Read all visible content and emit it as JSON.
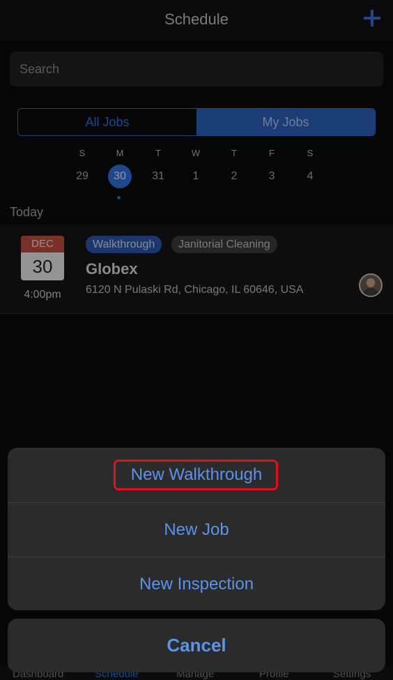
{
  "header": {
    "title": "Schedule",
    "add_icon": "plus-icon",
    "accent_color": "#2f6fd6"
  },
  "search": {
    "placeholder": "Search",
    "value": ""
  },
  "segments": {
    "all": "All Jobs",
    "mine": "My Jobs",
    "selected": "My Jobs"
  },
  "week": [
    {
      "label": "S",
      "date": "29",
      "selected": false
    },
    {
      "label": "M",
      "date": "30",
      "selected": true
    },
    {
      "label": "T",
      "date": "31",
      "selected": false
    },
    {
      "label": "W",
      "date": "1",
      "selected": false
    },
    {
      "label": "T",
      "date": "2",
      "selected": false
    },
    {
      "label": "F",
      "date": "3",
      "selected": false
    },
    {
      "label": "S",
      "date": "4",
      "selected": false
    }
  ],
  "section": {
    "today": "Today"
  },
  "job": {
    "month": "DEC",
    "day": "30",
    "time": "4:00pm",
    "tags": [
      "Walkthrough",
      "Janitorial Cleaning"
    ],
    "client": "Globex",
    "address": "6120 N Pulaski Rd, Chicago, IL 60646, USA",
    "avatar_icon": "user-avatar-icon"
  },
  "tabbar": [
    "Dashboard",
    "Schedule",
    "Manage",
    "Profile",
    "Settings"
  ],
  "action_sheet": {
    "items": [
      "New Walkthrough",
      "New Job",
      "New Inspection"
    ],
    "cancel": "Cancel",
    "highlight_color": "#e0101e"
  }
}
